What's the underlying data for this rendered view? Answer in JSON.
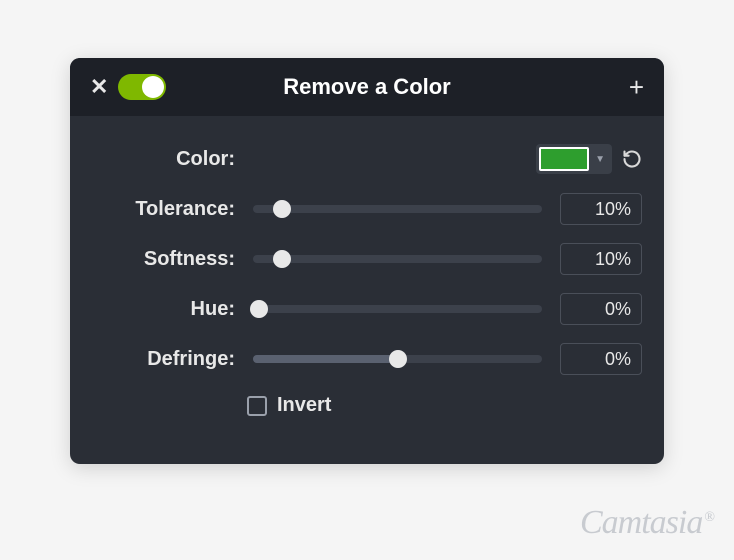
{
  "header": {
    "title": "Remove a Color"
  },
  "controls": {
    "color": {
      "label": "Color:",
      "swatch": "#2e9e2e"
    },
    "tolerance": {
      "label": "Tolerance:",
      "value": "10%",
      "percent": 10
    },
    "softness": {
      "label": "Softness:",
      "value": "10%",
      "percent": 10
    },
    "hue": {
      "label": "Hue:",
      "value": "0%",
      "percent": 0
    },
    "defringe": {
      "label": "Defringe:",
      "value": "0%",
      "thumb_percent": 50,
      "fill_percent": 50
    },
    "invert": {
      "label": "Invert",
      "checked": false
    }
  },
  "watermark": {
    "text": "Camtasia",
    "mark": "®"
  }
}
